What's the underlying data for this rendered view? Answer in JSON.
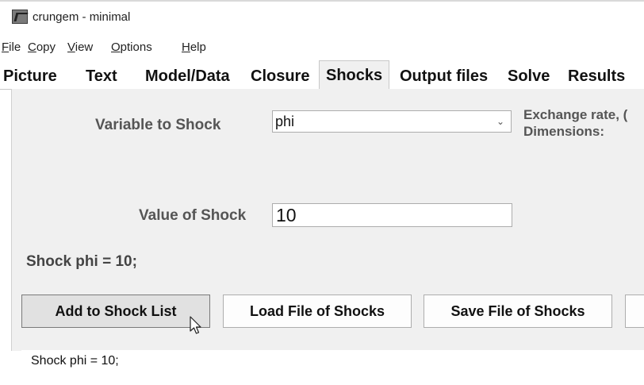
{
  "window": {
    "title": "crungem - minimal"
  },
  "menu": [
    {
      "key": "F",
      "rest": "ile"
    },
    {
      "key": "C",
      "rest": "opy"
    },
    {
      "key": "V",
      "rest": "iew"
    },
    {
      "key": "O",
      "rest": "ptions"
    },
    {
      "key": "H",
      "rest": "elp"
    }
  ],
  "tabs": [
    "Picture",
    "Text",
    "Model/Data",
    "Closure",
    "Shocks",
    "Output files",
    "Solve",
    "Results"
  ],
  "active_tab": "Shocks",
  "form": {
    "variable_label": "Variable to Shock",
    "variable_value": "phi",
    "info_line1": "Exchange rate, (",
    "info_line2": "Dimensions:",
    "value_label": "Value of Shock",
    "value_value": "10",
    "shock_statement": "Shock phi = 10;"
  },
  "buttons": {
    "add": "Add to Shock List",
    "load": "Load File of Shocks",
    "save": "Save File of Shocks"
  },
  "shock_list": [
    "Shock phi = 10;"
  ]
}
